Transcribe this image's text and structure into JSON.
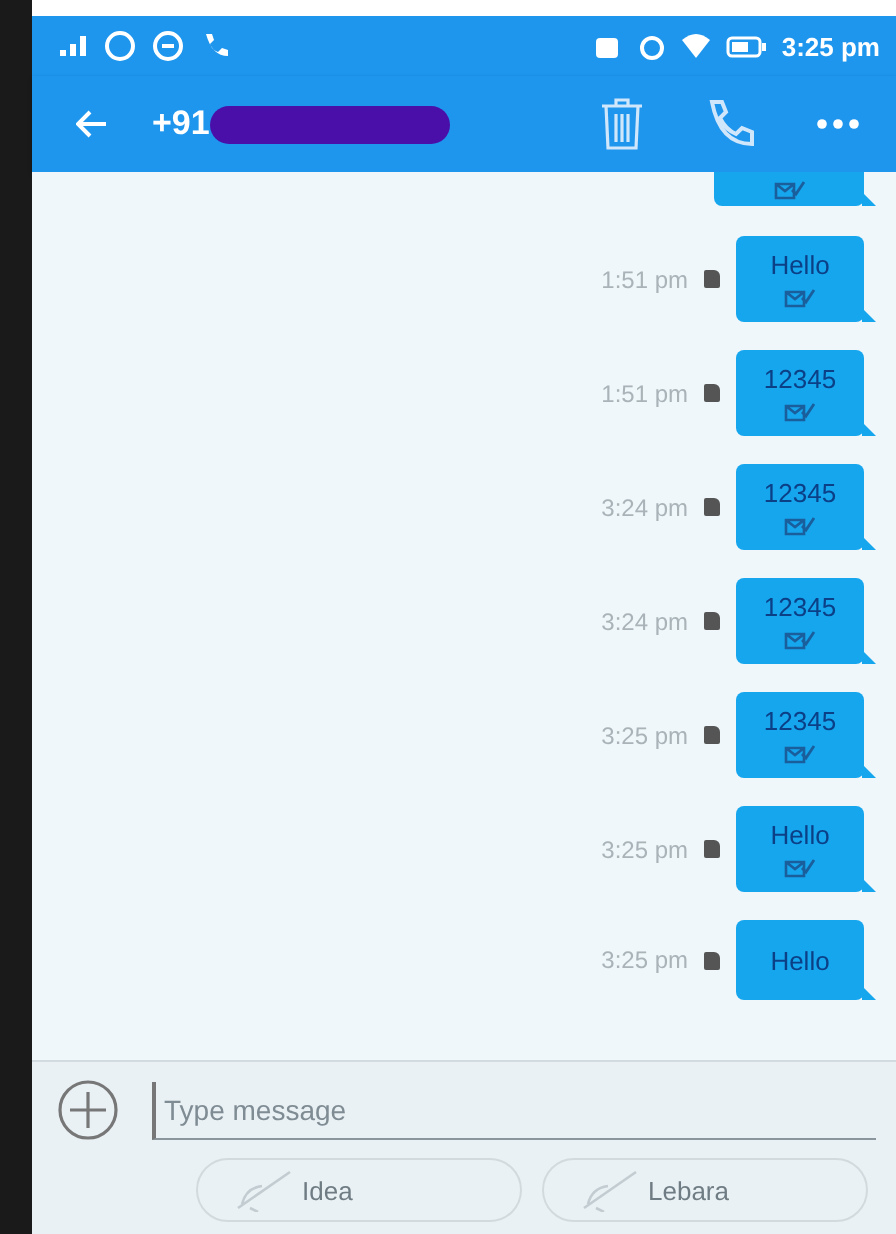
{
  "status_bar": {
    "time": "3:25 pm"
  },
  "header": {
    "contact": "+91"
  },
  "messages": [
    {
      "kind": "partial",
      "delivered": true
    },
    {
      "kind": "full",
      "text": "Hello",
      "time": "1:51 pm",
      "delivered": true
    },
    {
      "kind": "full",
      "text": "12345",
      "time": "1:51 pm",
      "delivered": true
    },
    {
      "kind": "full",
      "text": "12345",
      "time": "3:24 pm",
      "delivered": true
    },
    {
      "kind": "full",
      "text": "12345",
      "time": "3:24 pm",
      "delivered": true
    },
    {
      "kind": "full",
      "text": "12345",
      "time": "3:25 pm",
      "delivered": true
    },
    {
      "kind": "full",
      "text": "Hello",
      "time": "3:25 pm",
      "delivered": true
    },
    {
      "kind": "full",
      "text": "Hello",
      "time": "3:25 pm",
      "delivered": false
    }
  ],
  "compose": {
    "placeholder": "Type message"
  },
  "sim_buttons": [
    {
      "label": "Idea"
    },
    {
      "label": "Lebara"
    }
  ]
}
